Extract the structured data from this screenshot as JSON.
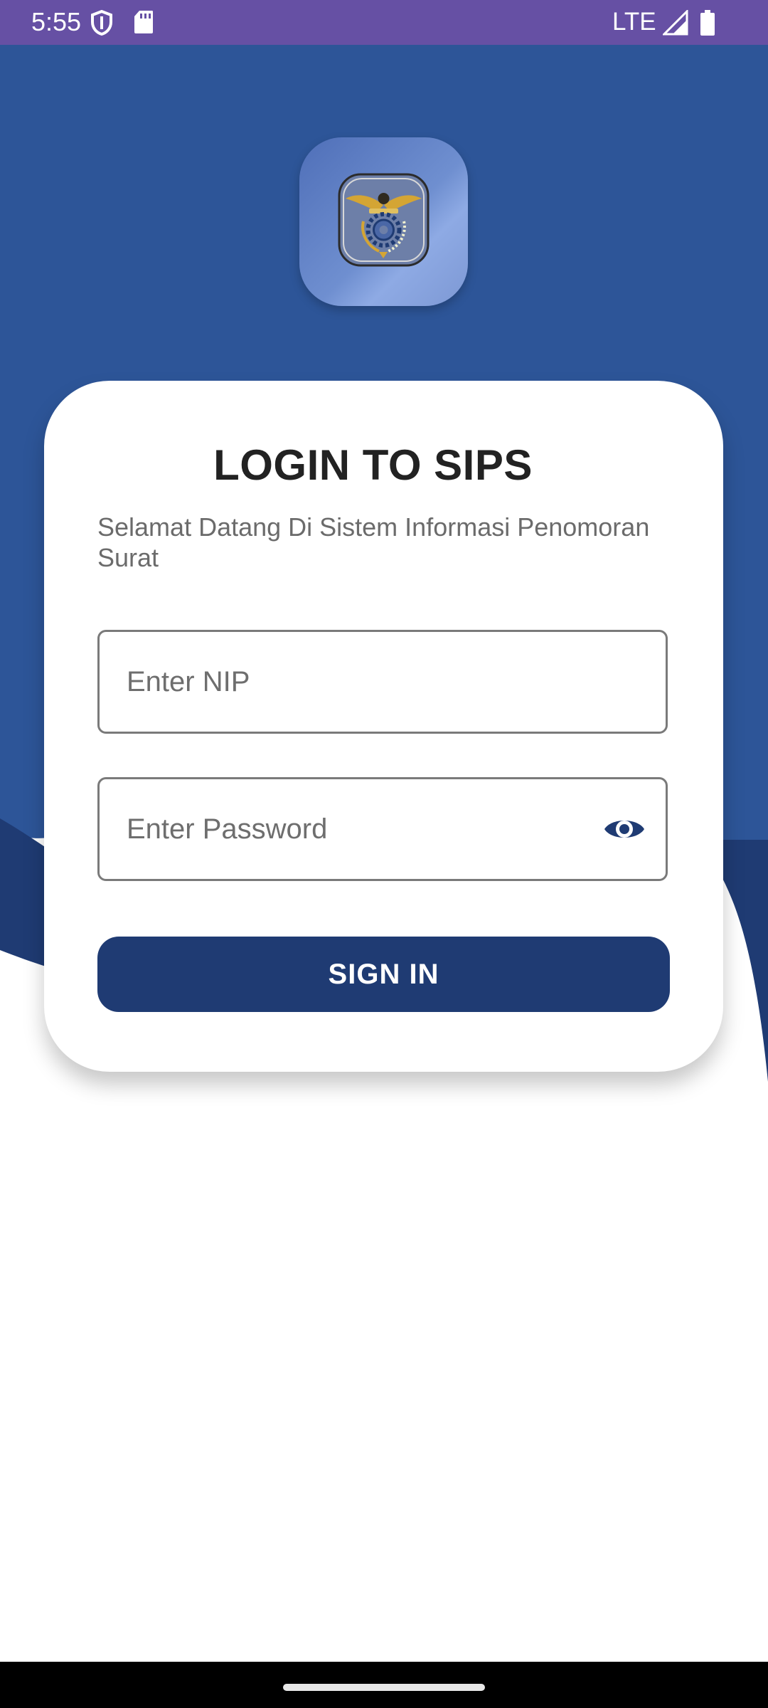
{
  "status_bar": {
    "time": "5:55",
    "network": "LTE",
    "icons": [
      "shield-icon",
      "sd-card-icon",
      "signal-icon",
      "battery-icon"
    ],
    "background": "#6650a4"
  },
  "app": {
    "icon_name": "sips-emblem-icon"
  },
  "login": {
    "title": "LOGIN TO SIPS",
    "subtitle": "Selamat Datang Di Sistem Informasi Penomoran Surat",
    "nip_placeholder": "Enter NIP",
    "nip_value": "",
    "password_placeholder": "Enter Password",
    "password_value": "",
    "toggle_icon": "eye-icon",
    "sign_in_label": "SIGN IN"
  },
  "colors": {
    "background_blue": "#2d5598",
    "wave_dark": "#1f3b73",
    "button": "#1f3b73",
    "card": "#ffffff"
  }
}
